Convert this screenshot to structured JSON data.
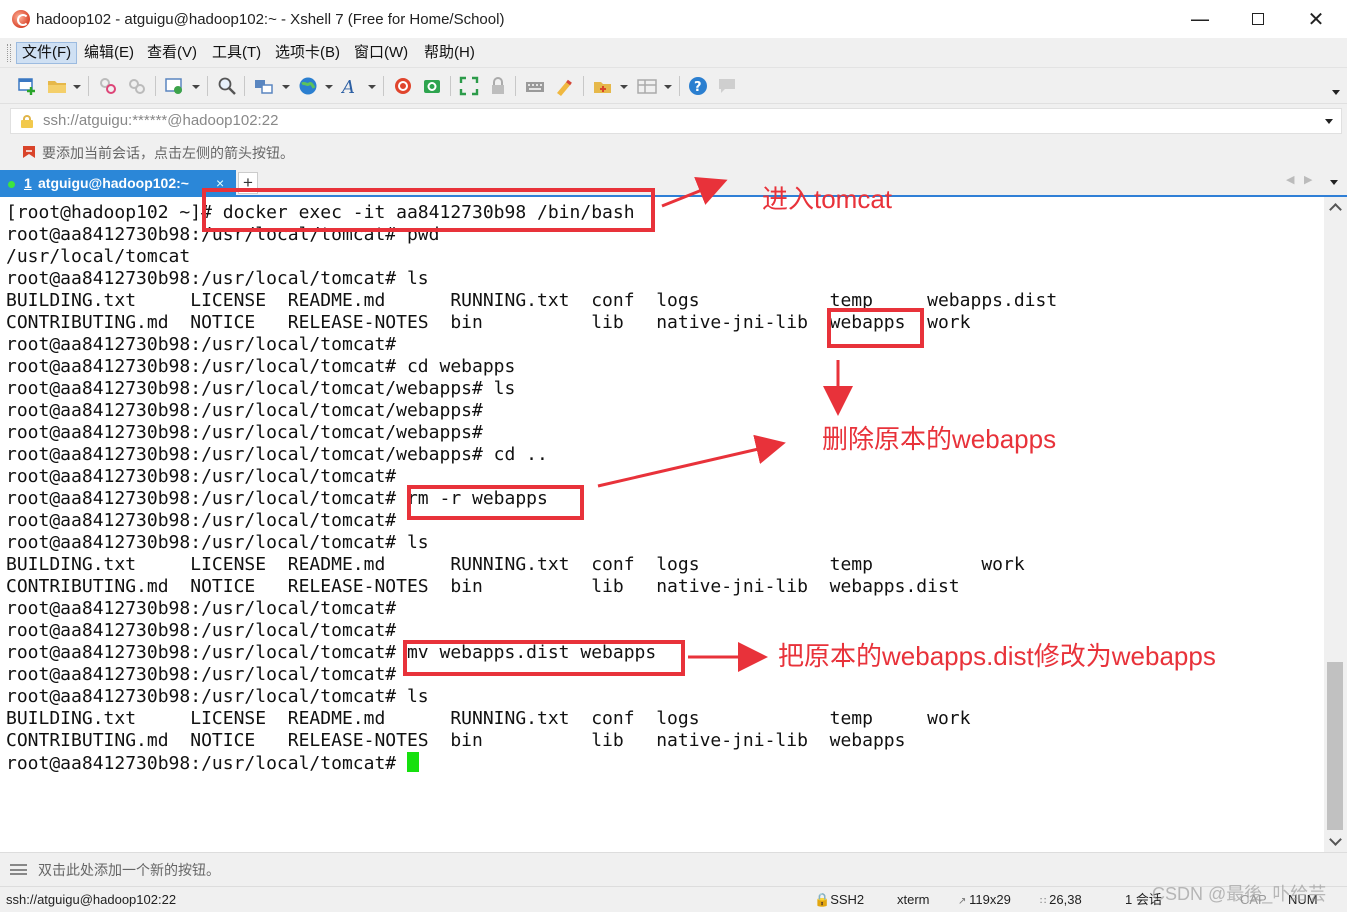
{
  "window": {
    "title": "hadoop102 - atguigu@hadoop102:~ - Xshell 7 (Free for Home/School)",
    "minimize": "—",
    "close": "✕"
  },
  "menu": [
    "文件(F)",
    "编辑(E)",
    "查看(V)",
    "工具(T)",
    "选项卡(B)",
    "窗口(W)",
    "帮助(H)"
  ],
  "toolbar": {
    "icons": [
      "new-session-icon",
      "open-folder-icon",
      "disconnect-icon",
      "reconnect-icon",
      "properties-icon",
      "find-icon",
      "transfer-icon",
      "globe-icon",
      "font-icon",
      "xshell-icon",
      "xftp-icon",
      "fullscreen-icon",
      "lock-icon",
      "keyboard-icon",
      "highlight-icon",
      "script-icon",
      "layout-icon",
      "help-icon",
      "chat-icon"
    ]
  },
  "address": {
    "value": "ssh://atguigu:******@hadoop102:22"
  },
  "hint": {
    "text": "要添加当前会话，点击左侧的箭头按钮。"
  },
  "tabs": {
    "active": {
      "number": "1",
      "title": "atguigu@hadoop102:~",
      "close": "×"
    },
    "add": "+",
    "prev": "◀",
    "next": "▶"
  },
  "terminal": {
    "lines": [
      "[root@hadoop102 ~]# docker exec -it aa8412730b98 /bin/bash",
      "root@aa8412730b98:/usr/local/tomcat# pwd",
      "/usr/local/tomcat",
      "root@aa8412730b98:/usr/local/tomcat# ls",
      "BUILDING.txt     LICENSE  README.md      RUNNING.txt  conf  logs            temp     webapps.dist",
      "CONTRIBUTING.md  NOTICE   RELEASE-NOTES  bin          lib   native-jni-lib  webapps  work",
      "root@aa8412730b98:/usr/local/tomcat#",
      "root@aa8412730b98:/usr/local/tomcat# cd webapps",
      "root@aa8412730b98:/usr/local/tomcat/webapps# ls",
      "root@aa8412730b98:/usr/local/tomcat/webapps#",
      "root@aa8412730b98:/usr/local/tomcat/webapps#",
      "root@aa8412730b98:/usr/local/tomcat/webapps# cd ..",
      "root@aa8412730b98:/usr/local/tomcat#",
      "root@aa8412730b98:/usr/local/tomcat# rm -r webapps",
      "root@aa8412730b98:/usr/local/tomcat#",
      "root@aa8412730b98:/usr/local/tomcat# ls",
      "BUILDING.txt     LICENSE  README.md      RUNNING.txt  conf  logs            temp          work",
      "CONTRIBUTING.md  NOTICE   RELEASE-NOTES  bin          lib   native-jni-lib  webapps.dist",
      "root@aa8412730b98:/usr/local/tomcat#",
      "root@aa8412730b98:/usr/local/tomcat#",
      "root@aa8412730b98:/usr/local/tomcat# mv webapps.dist webapps",
      "root@aa8412730b98:/usr/local/tomcat#",
      "root@aa8412730b98:/usr/local/tomcat# ls",
      "BUILDING.txt     LICENSE  README.md      RUNNING.txt  conf  logs            temp     work",
      "CONTRIBUTING.md  NOTICE   RELEASE-NOTES  bin          lib   native-jni-lib  webapps",
      "root@aa8412730b98:/usr/local/tomcat# "
    ],
    "cursor_color": "#16e00e"
  },
  "annotations": {
    "color": "#e8323a",
    "enter_tomcat": "进入tomcat",
    "delete_webapps": "删除原本的webapps",
    "rename_dist": "把原本的webapps.dist修改为webapps"
  },
  "quickbar": {
    "text": "双击此处添加一个新的按钮。"
  },
  "status": {
    "connection": "ssh://atguigu@hadoop102:22",
    "protocol": "SSH2",
    "terminal_type": "xterm",
    "size": "119x29",
    "cursor_pos": "26,38",
    "sessions": "1 会话",
    "caps": "CAP",
    "num": "NUM",
    "watermark": "CSDN @最後_卟给芸"
  }
}
